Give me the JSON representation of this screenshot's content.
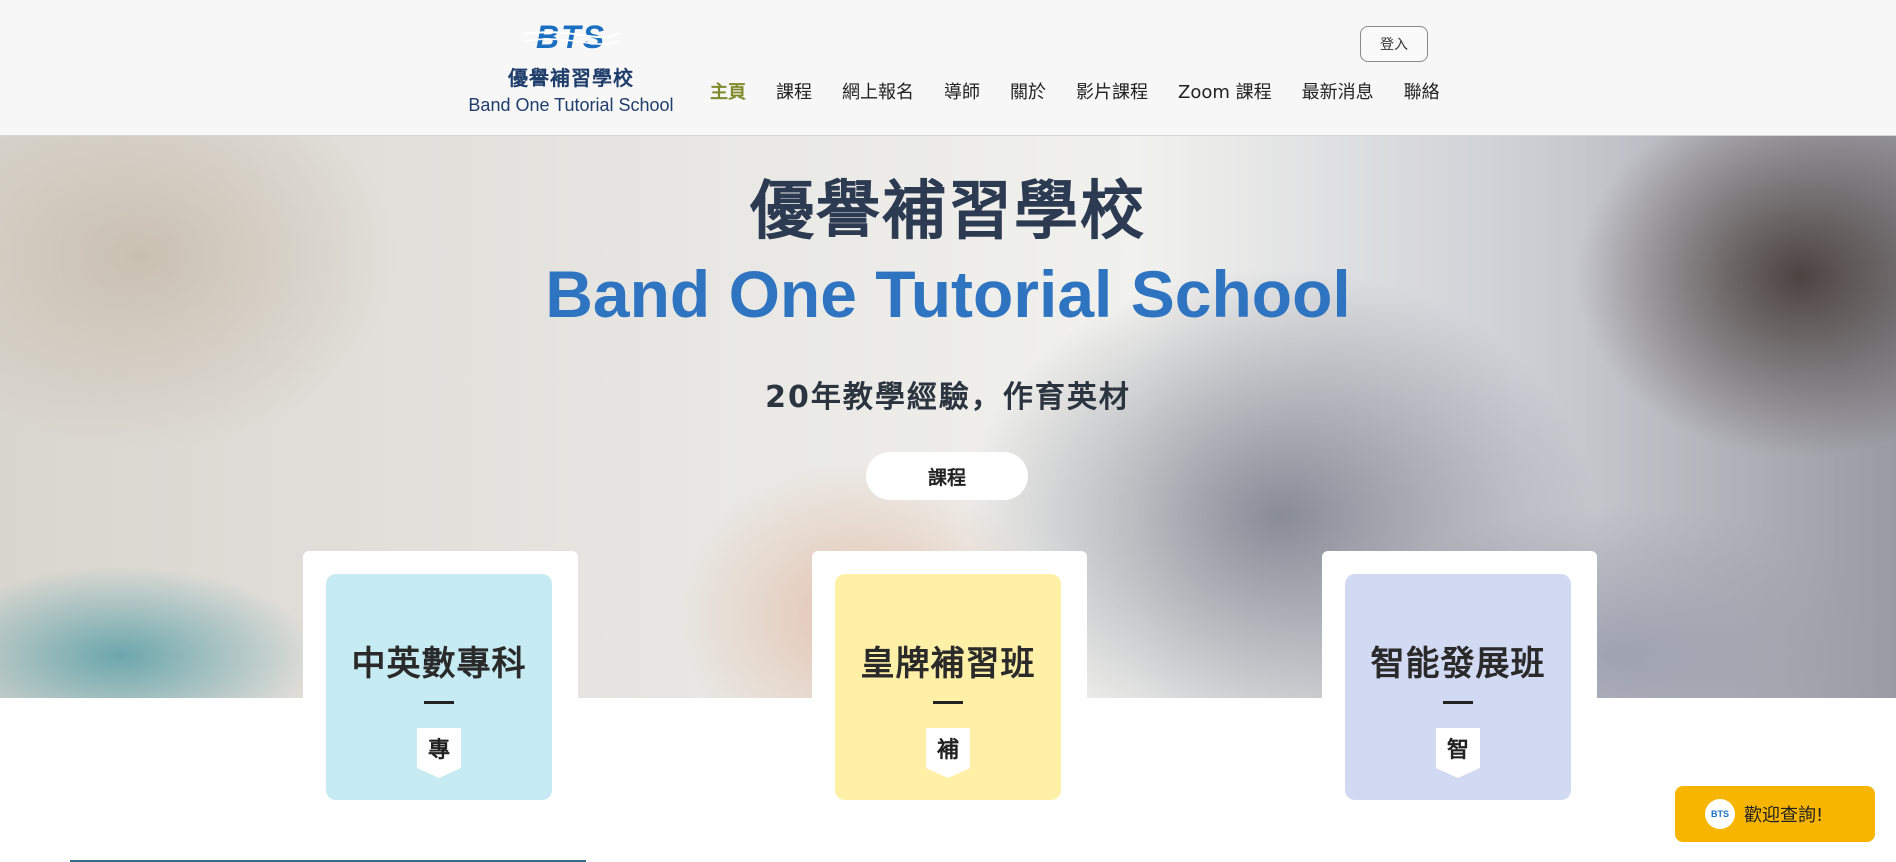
{
  "logo": {
    "mark_text": "BTS",
    "name_zh": "優譽補習學校",
    "name_en": "Band One Tutorial School",
    "color": "#1a6fc0"
  },
  "nav": {
    "items": [
      {
        "label": "主頁",
        "active": true
      },
      {
        "label": "課程",
        "active": false
      },
      {
        "label": "網上報名",
        "active": false
      },
      {
        "label": "導師",
        "active": false
      },
      {
        "label": "關於",
        "active": false
      },
      {
        "label": "影片課程",
        "active": false
      },
      {
        "label": "Zoom 課程",
        "active": false
      },
      {
        "label": "最新消息",
        "active": false
      },
      {
        "label": "聯絡",
        "active": false
      }
    ],
    "active_color": "#7e8b2b",
    "login_label": "登入"
  },
  "hero": {
    "title_zh": "優譽補習學校",
    "title_en": "Band One Tutorial School",
    "subtitle": "20年教學經驗，作育英材",
    "button_label": "課程",
    "title_en_color": "#2f74c0"
  },
  "cards": [
    {
      "title": "中英數專科",
      "tag": "專",
      "color": "#c6ebf2"
    },
    {
      "title": "皇牌補習班",
      "tag": "補",
      "color": "#fff0a8"
    },
    {
      "title": "智能發展班",
      "tag": "智",
      "color": "#d2d9f2"
    }
  ],
  "chat": {
    "label": "歡迎查詢!",
    "avatar_text": "BTS",
    "color": "#f7b500"
  }
}
